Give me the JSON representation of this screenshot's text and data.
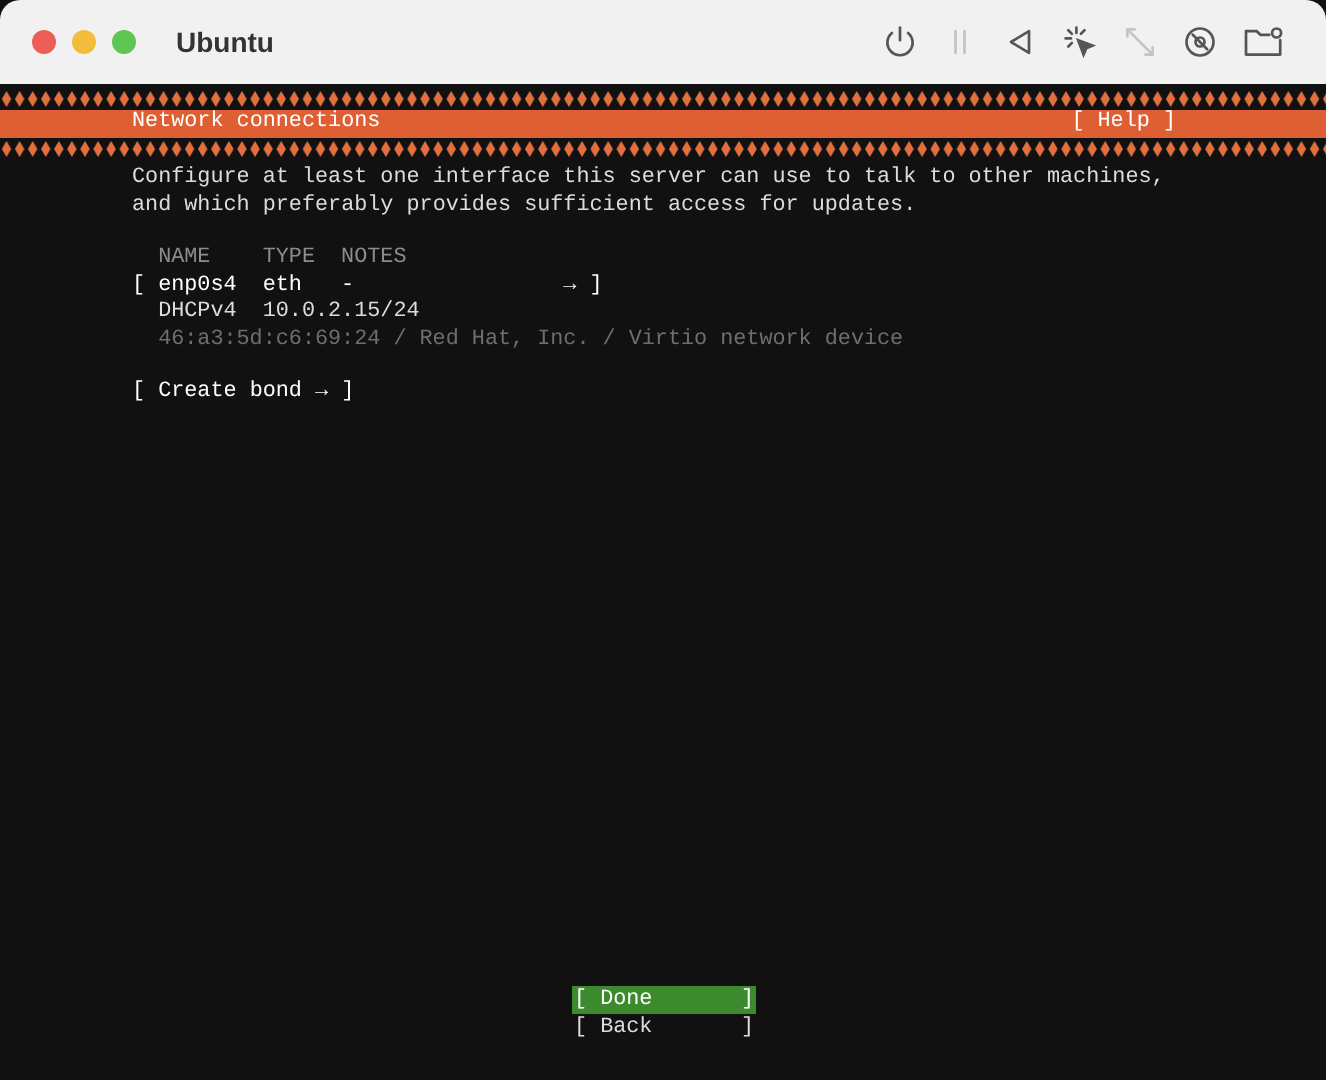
{
  "window": {
    "title": "Ubuntu"
  },
  "toolbar": [
    {
      "kind": "power",
      "disabled": false
    },
    {
      "kind": "pause",
      "disabled": true
    },
    {
      "kind": "back",
      "disabled": false
    },
    {
      "kind": "capture",
      "disabled": false
    },
    {
      "kind": "resize",
      "disabled": true
    },
    {
      "kind": "disc",
      "disabled": false
    },
    {
      "kind": "folder",
      "disabled": false
    }
  ],
  "header": {
    "title": "Network connections",
    "help": "[ Help ]"
  },
  "intro": [
    "Configure at least one interface this server can use to talk to other machines,",
    "and which preferably provides sufficient access for updates."
  ],
  "table": {
    "columns": [
      "NAME",
      "TYPE",
      "NOTES"
    ],
    "rows": [
      {
        "open": "[",
        "name": "enp0s4",
        "type": "eth",
        "notes": "-",
        "arrow": "→",
        "close": "]",
        "addresses": [
          {
            "method": "DHCPv4",
            "address": "10.0.2.15/24"
          }
        ],
        "info": "46:a3:5d:c6:69:24 / Red Hat, Inc. / Virtio network device"
      }
    ]
  },
  "create_bond": "[ Create bond → ]",
  "buttons": [
    {
      "label": "[ Done",
      "end": "]",
      "selected": true
    },
    {
      "label": "[ Back",
      "end": "]",
      "selected": false
    }
  ]
}
